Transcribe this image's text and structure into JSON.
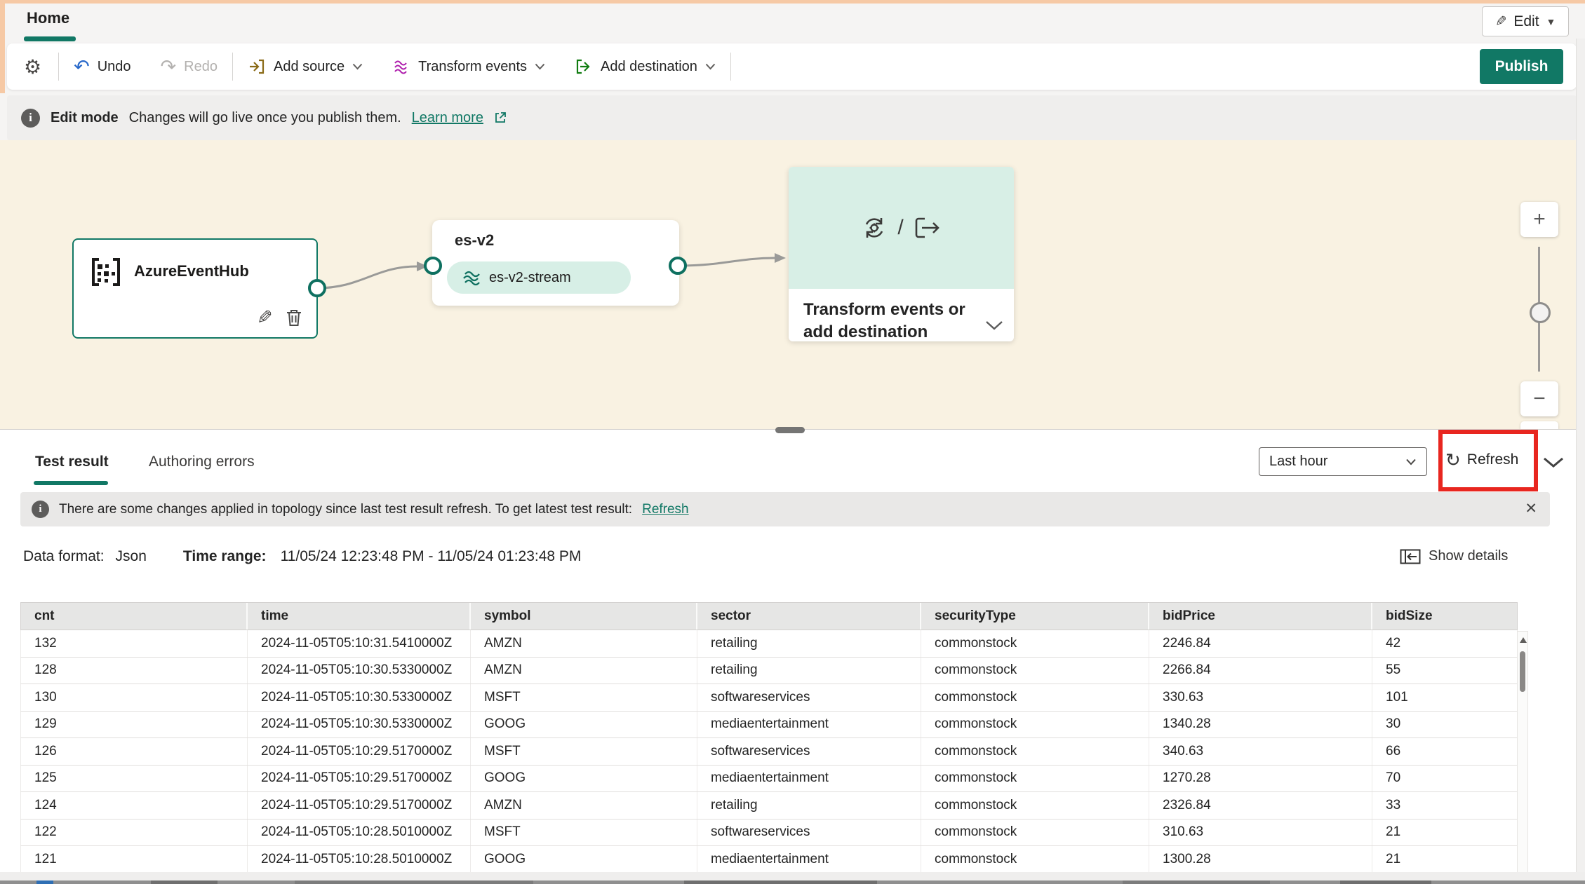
{
  "app": {
    "tab": "Home",
    "edit_button": "Edit",
    "publish": "Publish"
  },
  "toolbar": {
    "undo": "Undo",
    "redo": "Redo",
    "add_source": "Add source",
    "transform_events": "Transform events",
    "add_destination": "Add destination"
  },
  "edit_banner": {
    "title": "Edit mode",
    "message": "Changes will go live once you publish them.",
    "link": "Learn more"
  },
  "canvas": {
    "source_node": {
      "title": "AzureEventHub"
    },
    "stream_node": {
      "title": "es-v2",
      "stream_label": "es-v2-stream"
    },
    "placeholder_node": {
      "label": "Transform events or add destination",
      "separator": "/"
    },
    "zoom_controls": {
      "zoom_in": "+",
      "zoom_out": "−"
    }
  },
  "results": {
    "tabs": {
      "test_result": "Test result",
      "authoring_errors": "Authoring errors"
    },
    "time_filter": "Last hour",
    "refresh_button": "Refresh",
    "banner": {
      "message": "There are some changes applied in topology since last test result refresh. To get latest test result:",
      "link": "Refresh",
      "close": "✕"
    },
    "meta": {
      "data_format_label": "Data format:",
      "data_format_value": "Json",
      "time_range_label": "Time range:",
      "time_range_value": "11/05/24 12:23:48 PM - 11/05/24 01:23:48 PM",
      "show_details": "Show details"
    },
    "table": {
      "columns": [
        "cnt",
        "time",
        "symbol",
        "sector",
        "securityType",
        "bidPrice",
        "bidSize"
      ],
      "rows": [
        [
          "132",
          "2024-11-05T05:10:31.5410000Z",
          "AMZN",
          "retailing",
          "commonstock",
          "2246.84",
          "42"
        ],
        [
          "128",
          "2024-11-05T05:10:30.5330000Z",
          "AMZN",
          "retailing",
          "commonstock",
          "2266.84",
          "55"
        ],
        [
          "130",
          "2024-11-05T05:10:30.5330000Z",
          "MSFT",
          "softwareservices",
          "commonstock",
          "330.63",
          "101"
        ],
        [
          "129",
          "2024-11-05T05:10:30.5330000Z",
          "GOOG",
          "mediaentertainment",
          "commonstock",
          "1340.28",
          "30"
        ],
        [
          "126",
          "2024-11-05T05:10:29.5170000Z",
          "MSFT",
          "softwareservices",
          "commonstock",
          "340.63",
          "66"
        ],
        [
          "125",
          "2024-11-05T05:10:29.5170000Z",
          "GOOG",
          "mediaentertainment",
          "commonstock",
          "1270.28",
          "70"
        ],
        [
          "124",
          "2024-11-05T05:10:29.5170000Z",
          "AMZN",
          "retailing",
          "commonstock",
          "2326.84",
          "33"
        ],
        [
          "122",
          "2024-11-05T05:10:28.5010000Z",
          "MSFT",
          "softwareservices",
          "commonstock",
          "310.63",
          "21"
        ],
        [
          "121",
          "2024-11-05T05:10:28.5010000Z",
          "GOOG",
          "mediaentertainment",
          "commonstock",
          "1300.28",
          "21"
        ]
      ]
    }
  },
  "colors": {
    "accent": "#117865",
    "canvas_bg": "#f9f2e2",
    "mint": "#d8efe6",
    "highlight_red": "#e8261f"
  }
}
